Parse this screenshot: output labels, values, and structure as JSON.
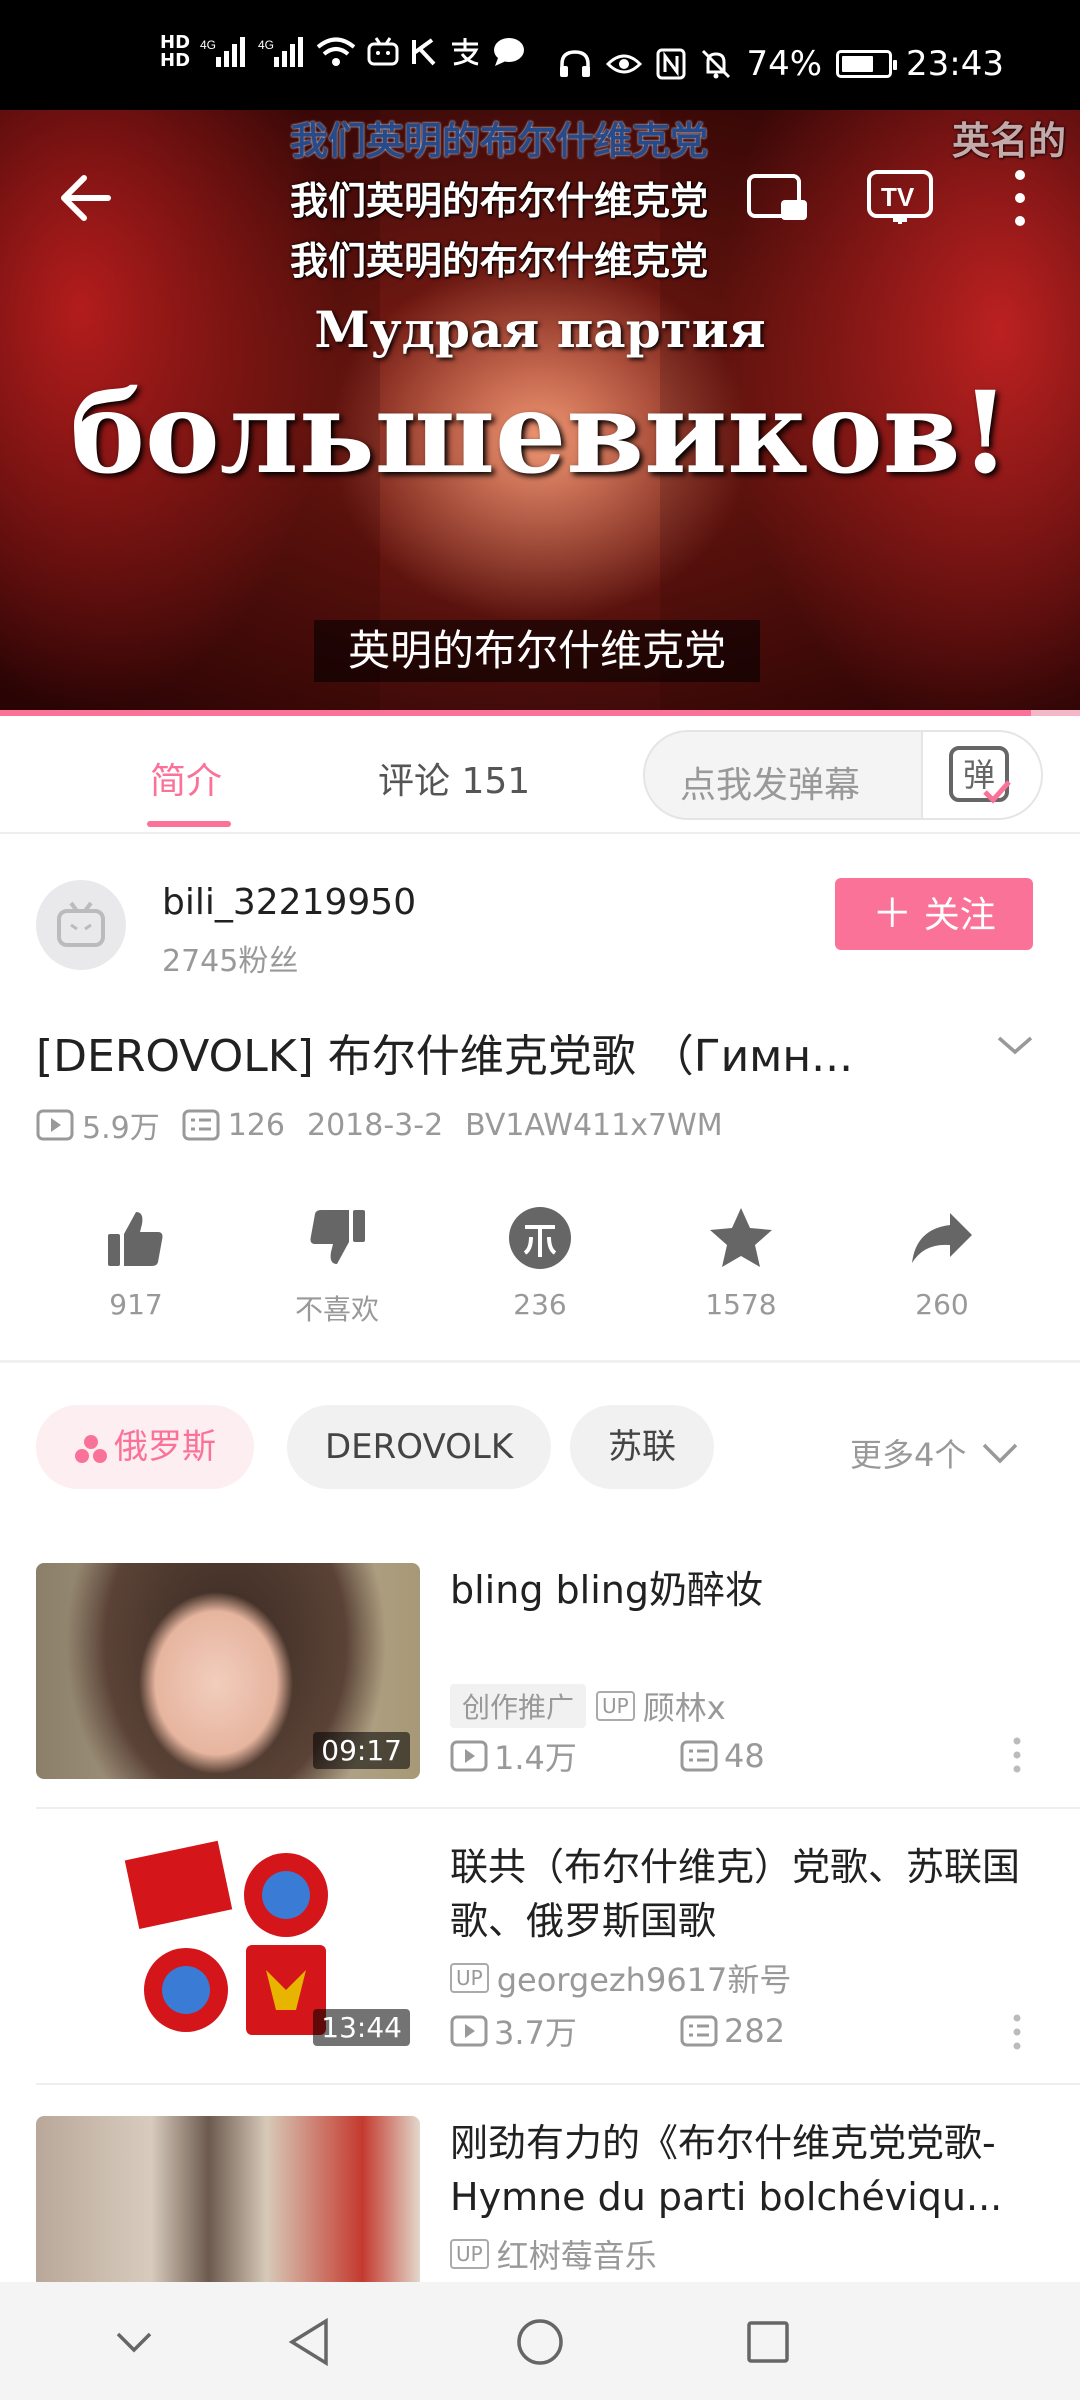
{
  "status_bar": {
    "battery": "74%",
    "battery_level": 0.74,
    "time": "23:43",
    "icons": [
      "hd-icon",
      "signal-icon",
      "signal-icon",
      "wifi-icon",
      "app-icon",
      "k-icon",
      "alipay-icon",
      "message-icon",
      "headphones-icon",
      "eye-icon",
      "nfc-icon",
      "mute-icon",
      "battery-icon"
    ]
  },
  "video": {
    "danmaku": [
      "我们英明的布尔什维克党",
      "我们英明的布尔什维克党",
      "我们英明的布尔什维克党",
      "英名的"
    ],
    "line1": "Мудрая партия",
    "line2": "большевиков!",
    "subtitle": "英明的布尔什维克党",
    "progress": 0.955
  },
  "tabs": {
    "intro": "简介",
    "comments": "评论 151",
    "danmaku_placeholder": "点我发弹幕",
    "danmaku_icon_label": "弹"
  },
  "uploader": {
    "name": "bili_32219950",
    "fans": "2745粉丝",
    "follow": "关注"
  },
  "video_info": {
    "title": "[DEROVOLK] 布尔什维克党歌 （Гимн...",
    "views": "5.9万",
    "danmaku_count": "126",
    "date": "2018-3-2",
    "bvid": "BV1AW411x7WM"
  },
  "actions": [
    {
      "name": "like",
      "label": "917"
    },
    {
      "name": "dislike",
      "label": "不喜欢"
    },
    {
      "name": "coin",
      "label": "236"
    },
    {
      "name": "favorite",
      "label": "1578"
    },
    {
      "name": "share",
      "label": "260"
    }
  ],
  "tags": [
    "俄罗斯",
    "DEROVOLK",
    "苏联"
  ],
  "more_tags": "更多4个",
  "recommendations": [
    {
      "title": "bling bling奶醉妆",
      "badge": "创作推广",
      "up": "顾林x",
      "views": "1.4万",
      "danmaku": "48",
      "duration": "09:17"
    },
    {
      "title": "联共（布尔什维克）党歌、苏联国歌、俄罗斯国歌",
      "up": "georgezh9617新号",
      "views": "3.7万",
      "danmaku": "282",
      "duration": "13:44"
    },
    {
      "title": "刚劲有力的《布尔什维克党党歌-Hymne du parti bolchéviqu...",
      "up": "红树莓音乐"
    }
  ],
  "up_label": "UP",
  "colors": {
    "accent": "#fb7299",
    "text": "#212121",
    "muted": "#999999"
  }
}
